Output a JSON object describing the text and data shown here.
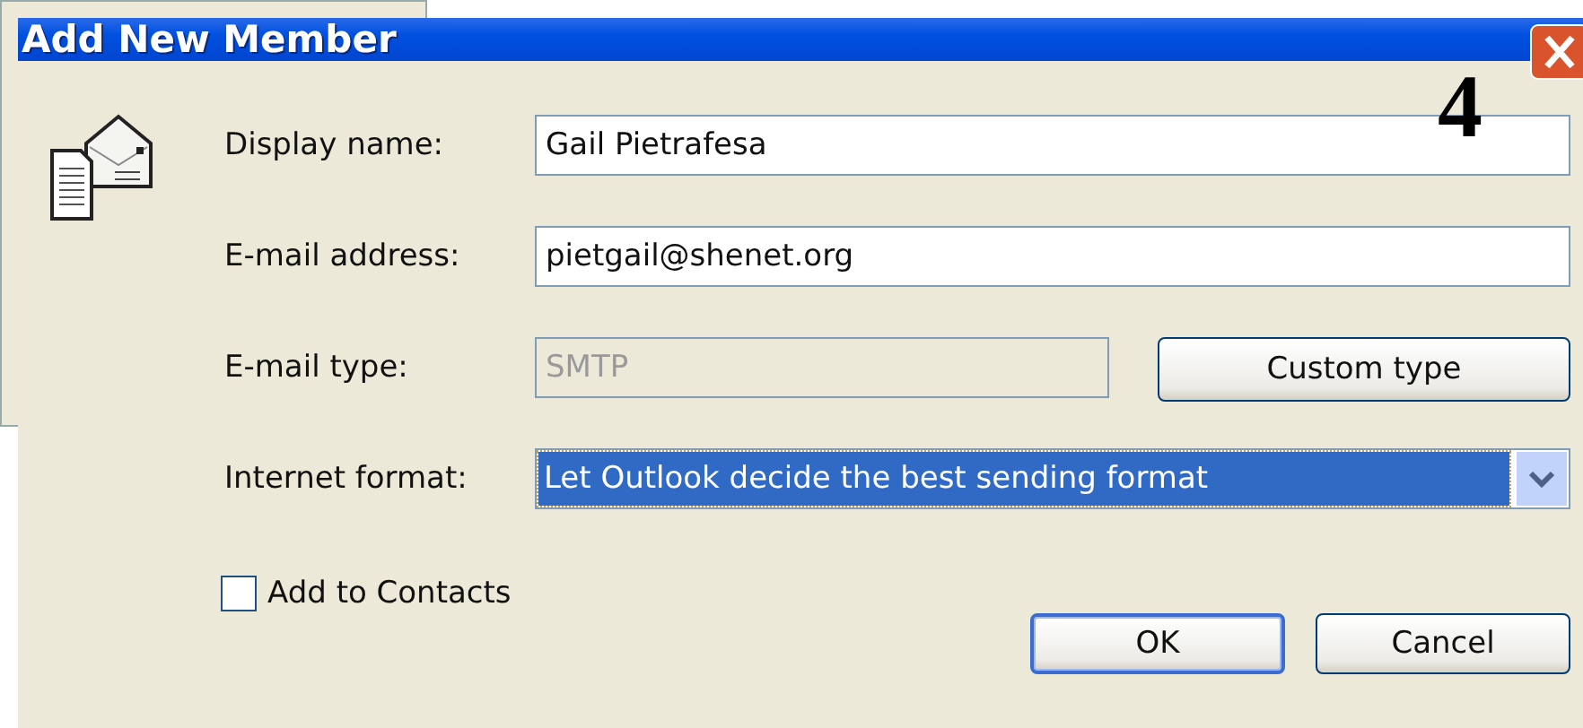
{
  "window": {
    "title": "Add New Member"
  },
  "fields": [
    {
      "kind": "text",
      "label": "Display name:",
      "value": "Gail Pietrafesa",
      "disabled": false
    },
    {
      "kind": "text",
      "label": "E-mail address:",
      "value": "pietgail@shenet.org",
      "disabled": false
    },
    {
      "kind": "text",
      "label": "E-mail type:",
      "value": "SMTP",
      "disabled": true,
      "button": "Custom type"
    },
    {
      "kind": "dropdown",
      "label": "Internet format:",
      "value": "Let Outlook decide the best sending format",
      "disabled": false
    }
  ],
  "checkbox": {
    "label": "Add to Contacts",
    "checked": false
  },
  "buttons": [
    {
      "label": "OK",
      "default": true
    },
    {
      "label": "Cancel",
      "default": false
    }
  ],
  "annotation": "4"
}
